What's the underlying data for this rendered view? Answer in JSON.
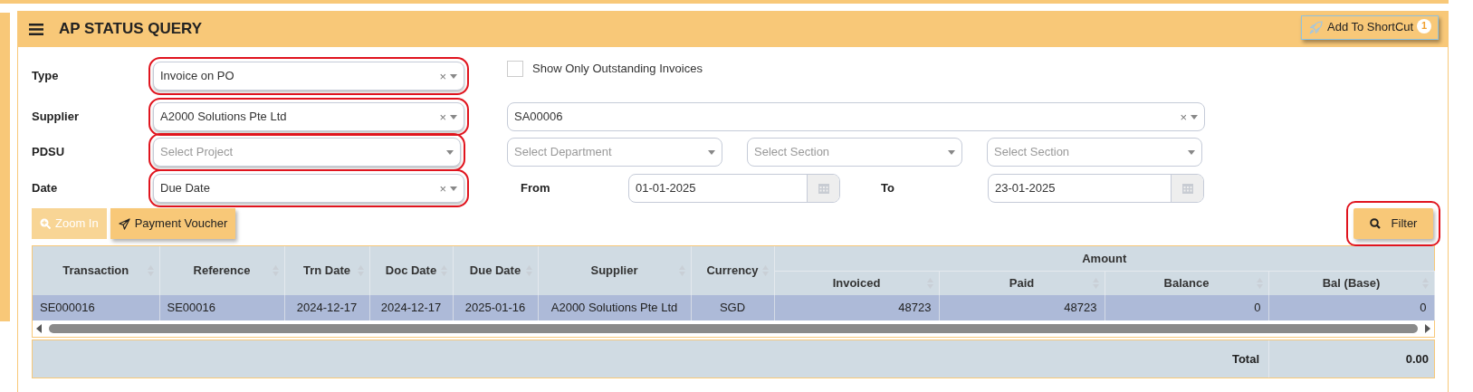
{
  "header": {
    "title": "AP STATUS QUERY",
    "shortcut": {
      "label": "Add To ShortCut",
      "badge": "1"
    }
  },
  "type_row": {
    "label": "Type",
    "select": {
      "value": "Invoice on PO",
      "clear": "×",
      "highlighted": true
    },
    "outstanding": {
      "label": "Show Only Outstanding Invoices",
      "checked": false
    }
  },
  "supplier_row": {
    "label": "Supplier",
    "select": {
      "value": "A2000 Solutions Pte Ltd",
      "clear": "×",
      "highlighted": true
    },
    "code": {
      "value": "SA00006",
      "clear": "×",
      "highlighted": false
    }
  },
  "pdsu_row": {
    "label": "PDSU",
    "selects": [
      {
        "placeholder": "Select Project",
        "highlighted": true
      },
      {
        "placeholder": "Select Department",
        "highlighted": false
      },
      {
        "placeholder": "Select Section",
        "highlighted": false
      },
      {
        "placeholder": "Select Section",
        "highlighted": false
      }
    ]
  },
  "date_row": {
    "label": "Date",
    "select": {
      "value": "Due Date",
      "clear": "×",
      "highlighted": true
    },
    "from": {
      "label": "From",
      "value": "01-01-2025"
    },
    "to": {
      "label": "To",
      "value": "23-01-2025"
    }
  },
  "toolbar": [
    {
      "label": "Zoom In",
      "kind": "zoom",
      "disabled": true
    },
    {
      "label": "Payment Voucher",
      "kind": "send",
      "disabled": false
    }
  ],
  "filter": {
    "label": "Filter",
    "highlighted": true
  },
  "table": {
    "columns": [
      "Transaction",
      "Reference",
      "Trn Date",
      "Doc Date",
      "Due Date",
      "Supplier",
      "Currency"
    ],
    "amount_group": {
      "label": "Amount",
      "columns": [
        "Invoiced",
        "Paid",
        "Balance",
        "Bal (Base)"
      ]
    },
    "rows": [
      {
        "selected": true,
        "cells": [
          "SE000016",
          "SE00016",
          "2024-12-17",
          "2024-12-17",
          "2025-01-16",
          "A2000 Solutions Pte Ltd",
          "SGD",
          "48723",
          "48723",
          "0",
          "0"
        ]
      }
    ],
    "total_label": "Total",
    "total_value": "0.00"
  }
}
